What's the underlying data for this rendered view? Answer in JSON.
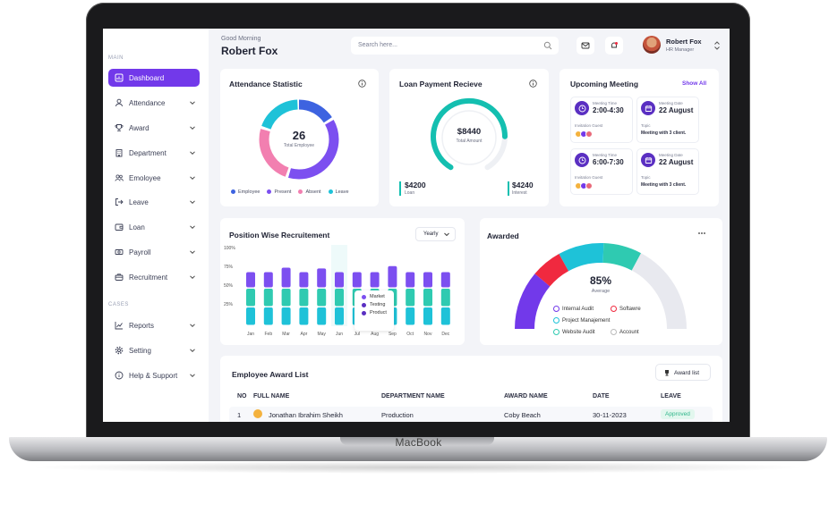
{
  "device": {
    "brand": "MacBook"
  },
  "sidebar": {
    "section_main": "MAIN",
    "section_cases": "CASES",
    "items": [
      {
        "label": "Dashboard",
        "icon": "dashboard-icon",
        "active": true
      },
      {
        "label": "Attendance",
        "icon": "user-icon"
      },
      {
        "label": "Award",
        "icon": "trophy-icon"
      },
      {
        "label": "Department",
        "icon": "building-icon"
      },
      {
        "label": "Emoloyee",
        "icon": "users-icon"
      },
      {
        "label": "Leave",
        "icon": "logout-icon"
      },
      {
        "label": "Loan",
        "icon": "wallet-icon"
      },
      {
        "label": "Payroll",
        "icon": "money-icon"
      },
      {
        "label": "Recruitment",
        "icon": "briefcase-icon"
      },
      {
        "label": "Reports",
        "icon": "chart-icon"
      },
      {
        "label": "Setting",
        "icon": "gear-icon"
      },
      {
        "label": "Help & Support",
        "icon": "help-icon"
      }
    ]
  },
  "header": {
    "greeting": "Good Morning",
    "user_name": "Robert Fox",
    "search_placeholder": "Search here...",
    "profile_name": "Robert Fox",
    "profile_role": "HR Manager"
  },
  "attendance": {
    "title": "Attendance Statistic",
    "total": "26",
    "total_label": "Total Employee",
    "legend": [
      {
        "label": "Employee",
        "color": "#3d63e0"
      },
      {
        "label": "Present",
        "color": "#7c4ff0"
      },
      {
        "label": "Absent",
        "color": "#f27fb0"
      },
      {
        "label": "Leave",
        "color": "#1ec2d8"
      }
    ]
  },
  "loan": {
    "title": "Loan Payment Recieve",
    "amount": "$8440",
    "amount_label": "Total Amount",
    "loan_value": "$4200",
    "loan_label": "Loan",
    "interest_value": "$4240",
    "interest_label": "Interest",
    "progress": 0.8
  },
  "meetings": {
    "title": "Upcoming Meeting",
    "show_all": "Show All",
    "time_label": "Meeting Time",
    "date_label": "Meeting Date",
    "guest_label": "Invitation Guest",
    "topic_label": "Topic",
    "items": [
      {
        "time": "2:00-4:30",
        "date": "22 August",
        "topic": "Meeting with 3 client."
      },
      {
        "time": "6:00-7:30",
        "date": "22 August",
        "topic": "Meeting with 3 client."
      }
    ]
  },
  "recruitment": {
    "title": "Position Wise Recruitement",
    "period": "Yearly",
    "tooltip": [
      "Market",
      "Testing",
      "Product"
    ]
  },
  "chart_data": {
    "type": "bar",
    "categories": [
      "Jan",
      "Feb",
      "Mar",
      "Apr",
      "May",
      "Jun",
      "Jul",
      "Aug",
      "Sep",
      "Oct",
      "Nov",
      "Dec"
    ],
    "yticks": [
      "100%",
      "75%",
      "50%",
      "25%"
    ],
    "ylim": [
      0,
      100
    ],
    "highlight": "Jun",
    "series": [
      {
        "name": "Product",
        "color": "#1ec2d8",
        "values": [
          25,
          25,
          25,
          25,
          25,
          25,
          25,
          25,
          25,
          25,
          25,
          25
        ]
      },
      {
        "name": "Testing",
        "color": "#2fcab1",
        "values": [
          25,
          25,
          25,
          25,
          25,
          25,
          25,
          25,
          25,
          25,
          25,
          25
        ]
      },
      {
        "name": "Market",
        "color": "#7c4ff0",
        "values": [
          22,
          22,
          28,
          22,
          27,
          22,
          22,
          22,
          30,
          22,
          22,
          22
        ]
      }
    ]
  },
  "awarded": {
    "title": "Awarded",
    "percent": "85%",
    "percent_label": "Average",
    "legend": [
      "Internal Audit",
      "Softawre",
      "Project Manajement",
      "Website Audit",
      "Account"
    ],
    "colors": [
      "#7239ea",
      "#f0293f",
      "#1ec2d8",
      "#2fcab1",
      "#e8e9ef"
    ]
  },
  "award_list": {
    "title": "Employee Award List",
    "button": "Award list",
    "columns": [
      "NO",
      "FULL NAME",
      "DEPARTMENT NAME",
      "AWARD NAME",
      "DATE",
      "LEAVE"
    ],
    "rows": [
      {
        "no": "1",
        "name": "Jonathan Ibrahim Sheikh",
        "dept": "Production",
        "award": "Coby Beach",
        "date": "30-11-2023",
        "status": "Approved"
      }
    ]
  }
}
